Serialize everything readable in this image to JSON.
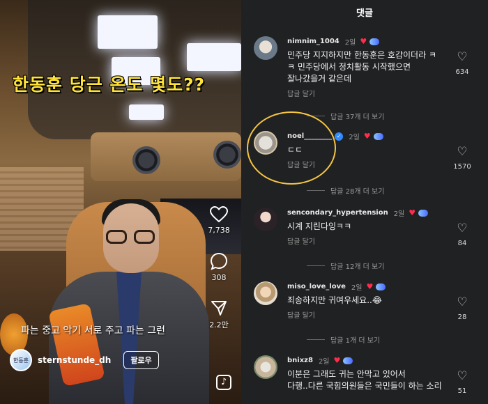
{
  "reel": {
    "caption_top": "한동훈 당근 온도 몇도??",
    "caption_bottom": "파는 중고 악기 서로 주고 파는 그런",
    "like_count": "7,738",
    "comment_count": "308",
    "share_count": "2.2만",
    "username": "sternstunde_dh",
    "avatar_label": "한동훈",
    "follow_label": "팔로우"
  },
  "comments_panel": {
    "title": "댓글",
    "reply_label": "답글 달기",
    "comments": [
      {
        "user": "nimnim_1004",
        "time": "2일",
        "text_line1": "민주당 지지하지만 한동훈은 호감이더라 ㅋ",
        "text_line2": "ㅋ 민주당에서 정치활동 시작했으면",
        "text_line3": "잘나갔을거 같은데",
        "likes": "634",
        "more_replies": "답글 37개 더 보기"
      },
      {
        "user": "noel________",
        "time": "2일",
        "text_line1": "ㄷㄷ",
        "likes": "1570",
        "more_replies": "답글 28개 더 보기"
      },
      {
        "user": "sencondary_hypertension",
        "time": "2일",
        "text_line1": "시계 지린다잉ㅋㅋ",
        "likes": "84",
        "more_replies": "답글 12개 더 보기"
      },
      {
        "user": "miso_love_love",
        "time": "2일",
        "text_line1": "죄송하지만 귀여우세요..😂",
        "likes": "28",
        "more_replies": "답글 1개 더 보기"
      },
      {
        "user": "bnixz8",
        "time": "2일",
        "text_line1": "이분은 그래도 귀는 안막고 있어서",
        "text_line2": "다행..다른 국힘의원들은 국민들이 하는 소리",
        "likes": "51"
      }
    ]
  },
  "colors": {
    "panel_bg": "#202123",
    "heart_red": "#ff2d4a",
    "highlight_circle": "#f5c542",
    "caption_yellow": "#ffe33a"
  }
}
